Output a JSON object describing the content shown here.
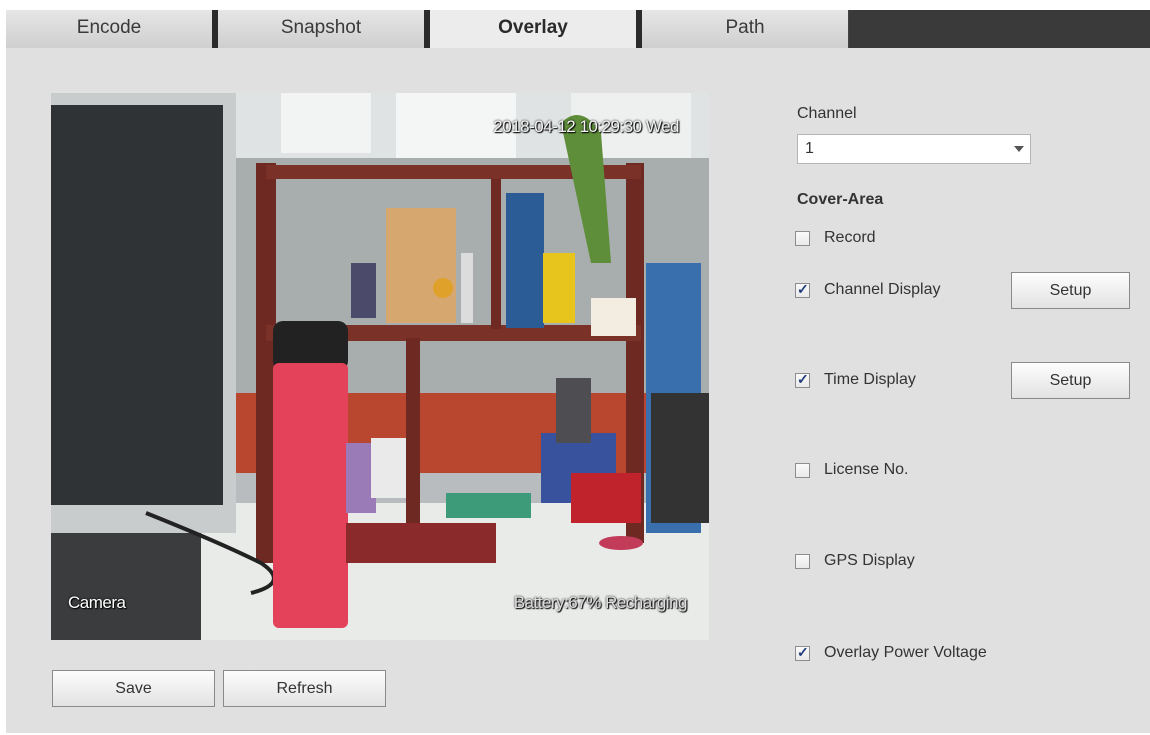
{
  "tabs": [
    {
      "label": "Encode",
      "active": false
    },
    {
      "label": "Snapshot",
      "active": false
    },
    {
      "label": "Overlay",
      "active": true
    },
    {
      "label": "Path",
      "active": false
    }
  ],
  "preview": {
    "time_overlay": "2018-04-12 10:29:30 Wed",
    "camera_overlay": "Camera",
    "battery_overlay": "Battery:67%  Recharging"
  },
  "buttons": {
    "save": "Save",
    "refresh": "Refresh",
    "setup": "Setup"
  },
  "channel": {
    "label": "Channel",
    "value": "1"
  },
  "cover_area": {
    "label": "Cover-Area",
    "options": [
      {
        "label": "Record",
        "checked": false
      },
      {
        "label": "Channel Display",
        "checked": true
      },
      {
        "label": "Time Display",
        "checked": true
      },
      {
        "label": "License No.",
        "checked": false
      },
      {
        "label": "GPS Display",
        "checked": false
      },
      {
        "label": "Overlay Power Voltage",
        "checked": true
      }
    ]
  }
}
